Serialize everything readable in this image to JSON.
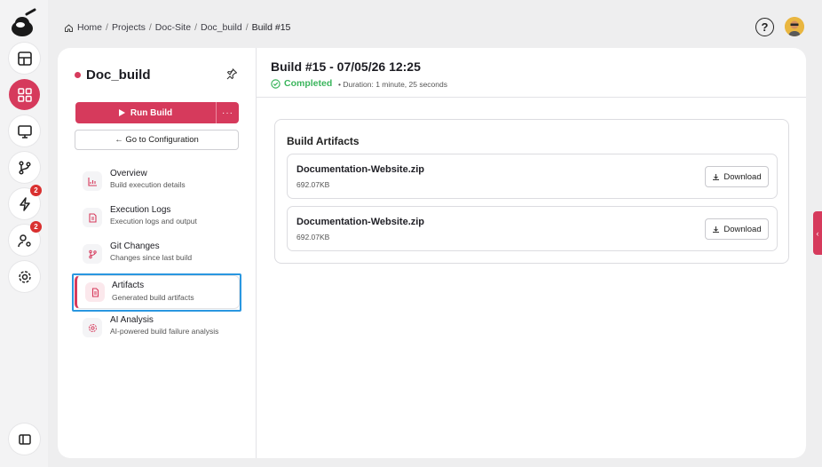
{
  "breadcrumb": {
    "items": [
      "Home",
      "Projects",
      "Doc-Site",
      "Doc_build"
    ],
    "current": "Build #15",
    "separator": "/"
  },
  "header": {
    "help_label": "?"
  },
  "rail": {
    "icons": [
      "dashboard-icon",
      "apps-grid-icon",
      "monitor-icon",
      "git-branch-icon",
      "lightning-icon",
      "user-settings-icon",
      "gear-icon",
      "sidebar-toggle-icon"
    ],
    "badges": {
      "lightning": "2",
      "user_settings": "2"
    }
  },
  "sidebar": {
    "title": "Doc_build",
    "run_label": "Run Build",
    "more_label": "···",
    "goto_label": "← Go to Configuration",
    "items": [
      {
        "label": "Overview",
        "sub": "Build execution details",
        "icon": "chart-icon"
      },
      {
        "label": "Execution Logs",
        "sub": "Execution logs and output",
        "icon": "document-icon"
      },
      {
        "label": "Git Changes",
        "sub": "Changes since last build",
        "icon": "git-branch-icon"
      },
      {
        "label": "Artifacts",
        "sub": "Generated build artifacts",
        "icon": "file-icon"
      },
      {
        "label": "AI Analysis",
        "sub": "AI-powered build failure analysis",
        "icon": "gear-icon"
      }
    ]
  },
  "build": {
    "title": "Build #15 - 07/05/26 12:25",
    "status": "Completed",
    "duration": "• Duration: 1 minute, 25 seconds"
  },
  "artifacts": {
    "heading": "Build Artifacts",
    "files": [
      {
        "name": "Documentation-Website.zip",
        "size": "692.07KB",
        "action": "Download"
      },
      {
        "name": "Documentation-Website.zip",
        "size": "692.07KB",
        "action": "Download"
      }
    ]
  },
  "edge_tab": {
    "label": "‹"
  },
  "colors": {
    "accent": "#d63a5c",
    "success": "#3ab55c",
    "highlight": "#2a97e0"
  }
}
